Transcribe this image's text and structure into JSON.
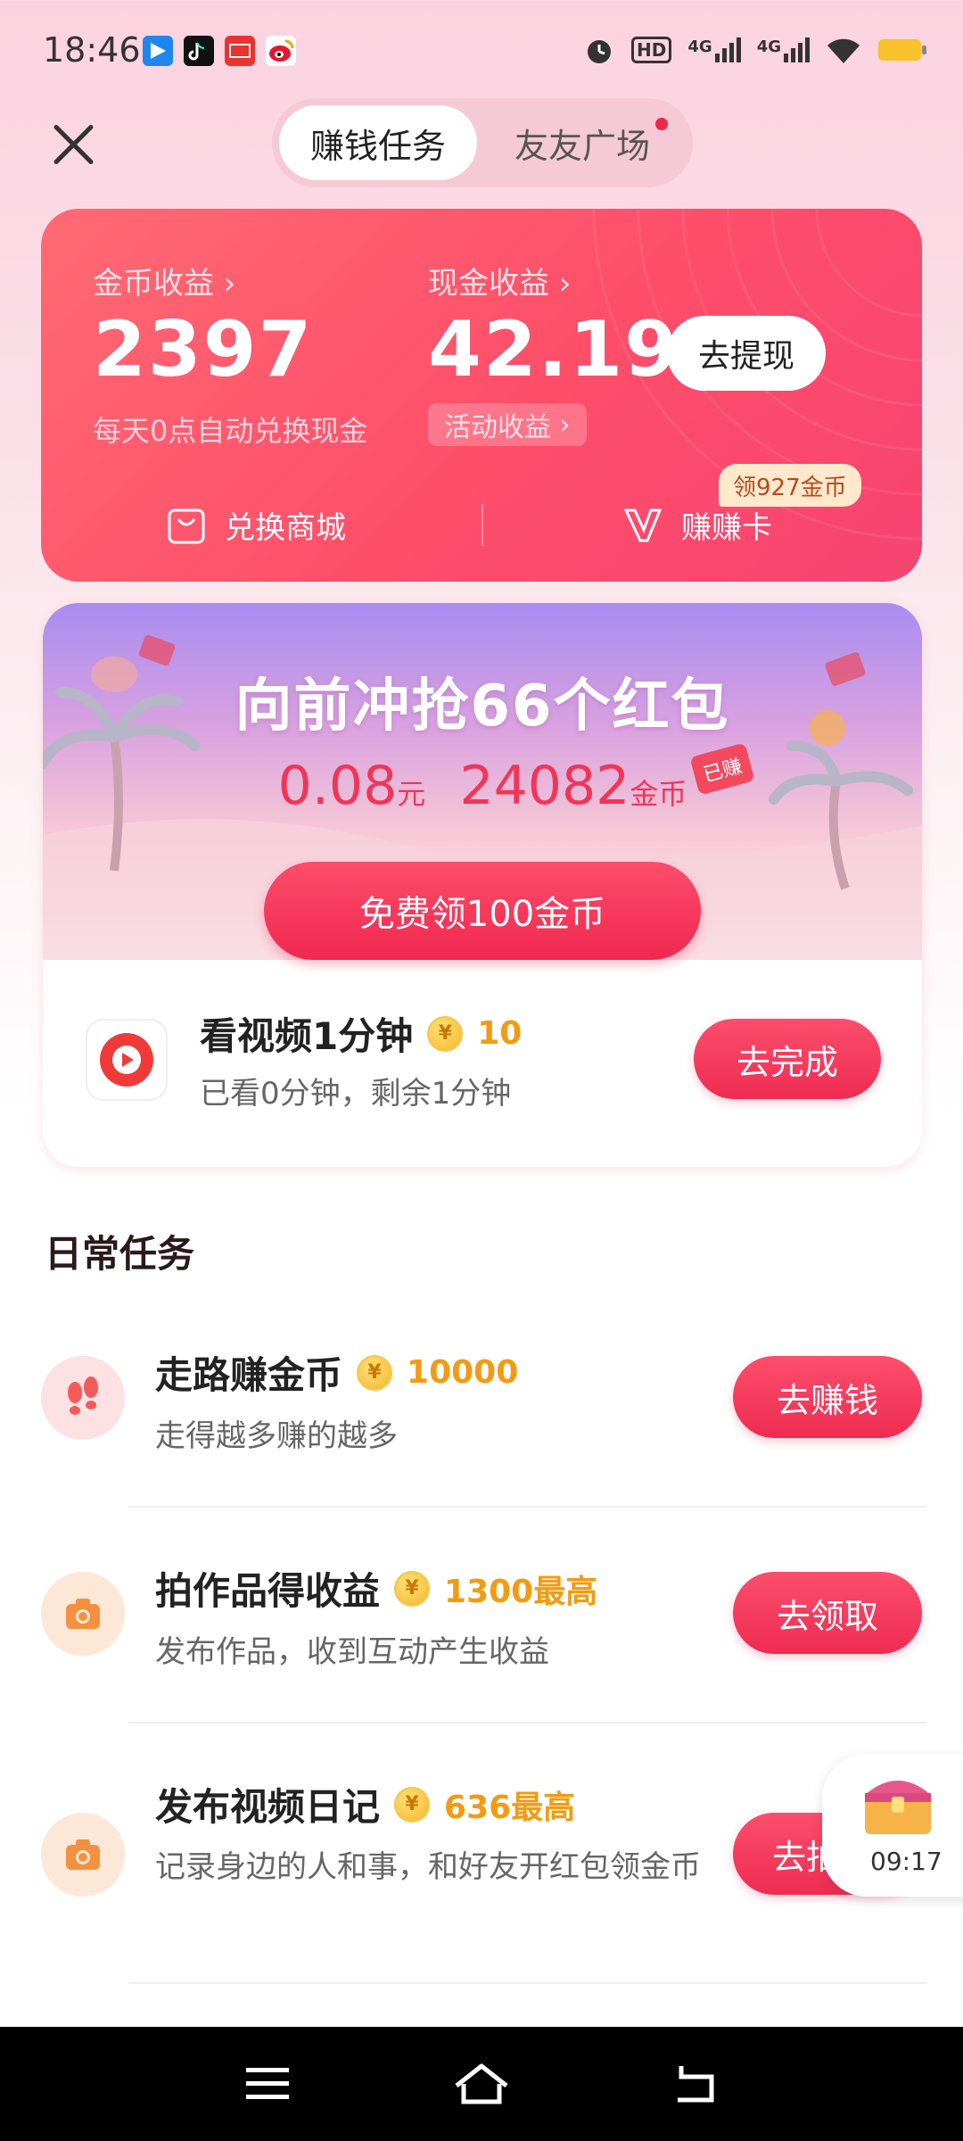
{
  "status_bar": {
    "time": "18:46",
    "icons": [
      "blue-app-icon",
      "tiktok-icon",
      "toutiao-icon",
      "weibo-icon"
    ],
    "right_icons": [
      "alarm-icon",
      "hd-icon",
      "4g-signal-icon",
      "4g-signal-icon",
      "wifi-icon",
      "battery-icon"
    ],
    "hd_label": "HD",
    "sig1_label": "4G",
    "sig2_label": "4G"
  },
  "header": {
    "tab_active": "赚钱任务",
    "tab_2": "友友广场"
  },
  "earnings": {
    "coin_label": "金币收益",
    "coin_value": "2397",
    "coin_note": "每天0点自动兑换现金",
    "cash_label": "现金收益",
    "cash_value": "42.19",
    "withdraw_label": "去提现",
    "activity_label": "活动收益",
    "shop_label": "兑换商城",
    "card_label": "赚赚卡",
    "card_badge": "领927金币"
  },
  "redpacket": {
    "title": "向前冲抢66个红包",
    "yuan_value": "0.08",
    "yuan_unit": "元",
    "coin_value": "24082",
    "coin_unit": "金币",
    "earned_tag": "已赚",
    "free_button": "免费领100金币"
  },
  "video_task": {
    "title": "看视频1分钟",
    "reward": "10",
    "desc": "已看0分钟，剩余1分钟",
    "button": "去完成"
  },
  "daily": {
    "section_title": "日常任务",
    "tasks": [
      {
        "title": "走路赚金币",
        "reward": "10000",
        "desc": "走得越多赚的越多",
        "button": "去赚钱",
        "icon": "footprints-icon"
      },
      {
        "title": "拍作品得收益",
        "reward": "1300最高",
        "desc": "发布作品，收到互动产生收益",
        "button": "去领取",
        "icon": "camera-icon"
      },
      {
        "title": "发布视频日记",
        "reward": "636最高",
        "desc": "记录身边的人和事，和好友开红包领金币",
        "button": "去拍",
        "icon": "camera-icon"
      }
    ]
  },
  "floating": {
    "timer": "09:17",
    "icon": "treasure-chest-icon"
  },
  "colors": {
    "accent": "#f2254b",
    "coin": "#f29b12",
    "card_bg": "#fe4e6a"
  }
}
